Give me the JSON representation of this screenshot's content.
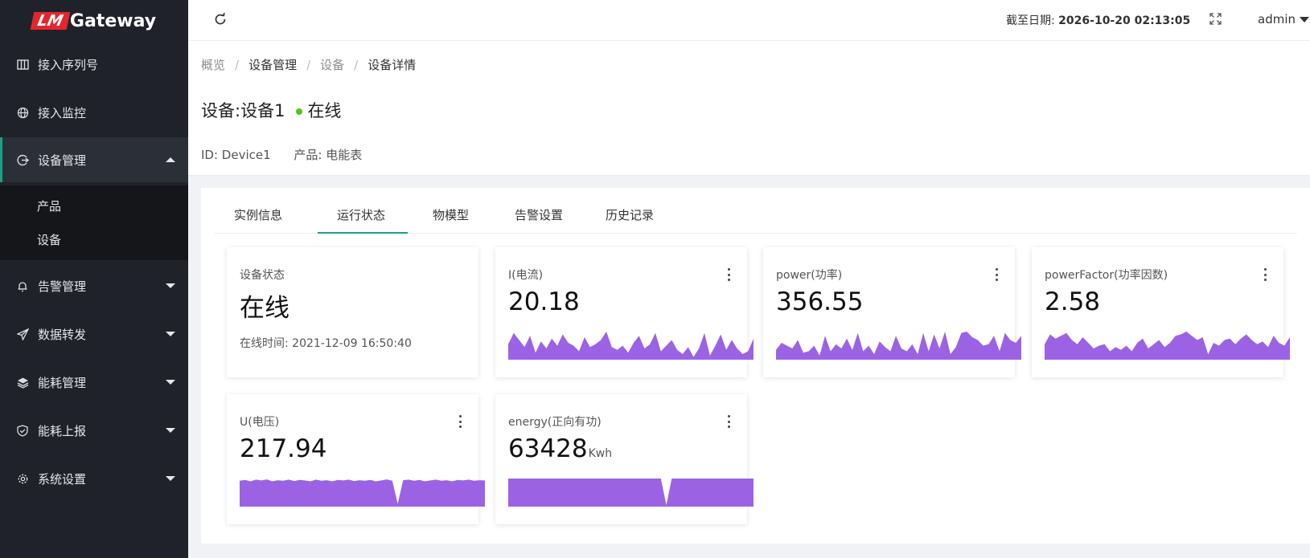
{
  "app": {
    "logo_mark": "LM",
    "logo_text": "Gateway"
  },
  "sidebar": {
    "items": [
      {
        "label": "接入序列号",
        "icon": "columns-icon"
      },
      {
        "label": "接入监控",
        "icon": "globe-icon"
      },
      {
        "label": "设备管理",
        "icon": "device-icon",
        "expanded": true
      },
      {
        "label": "告警管理",
        "icon": "bell-icon"
      },
      {
        "label": "数据转发",
        "icon": "send-icon"
      },
      {
        "label": "能耗管理",
        "icon": "layers-icon"
      },
      {
        "label": "能耗上报",
        "icon": "shield-check-icon"
      },
      {
        "label": "系统设置",
        "icon": "gear-icon"
      }
    ],
    "submenu": [
      "产品",
      "设备"
    ]
  },
  "header": {
    "date_label": "截至日期: ",
    "date_value": "2026-10-20 02:13:05",
    "user": "admin"
  },
  "breadcrumb": {
    "items": [
      "概览",
      "设备管理",
      "设备",
      "设备详情"
    ],
    "separator": "/"
  },
  "device": {
    "title": "设备:设备1",
    "status": "在线",
    "status_color": "#52c41a",
    "id_text": "ID: Device1",
    "product_text": "产品: 电能表"
  },
  "tabs": {
    "items": [
      "实例信息",
      "运行状态",
      "物模型",
      "告警设置",
      "历史记录"
    ],
    "active": "运行状态",
    "accent": "#1aa189"
  },
  "cards": {
    "status": {
      "title": "设备状态",
      "value": "在线",
      "time": "在线时间: 2021-12-09 16:50:40"
    },
    "metrics": [
      {
        "title": "I(电流)",
        "value": "20.18",
        "unit": "",
        "spark": [
          0.55,
          0.95,
          0.7,
          0.45,
          0.85,
          0.25,
          0.65,
          0.4,
          0.75,
          0.5,
          0.9,
          0.6,
          0.5,
          0.3,
          0.8,
          0.45,
          0.55,
          0.7,
          1.0,
          0.45,
          0.35,
          0.5,
          0.25,
          0.6,
          0.85,
          0.4,
          0.55,
          0.95,
          0.3,
          0.5,
          0.7,
          0.35,
          0.2,
          0.45,
          0.1,
          0.4,
          0.95,
          0.15,
          0.5,
          0.9,
          0.35,
          0.7,
          0.4,
          0.2,
          0.3,
          0.75
        ]
      },
      {
        "title": "power(功率)",
        "value": "356.55",
        "unit": "",
        "spark": [
          0.35,
          0.6,
          0.5,
          0.4,
          0.7,
          0.25,
          0.3,
          0.5,
          0.15,
          0.85,
          0.3,
          0.55,
          0.4,
          0.75,
          0.35,
          0.95,
          0.3,
          0.5,
          0.2,
          0.65,
          0.45,
          0.3,
          0.85,
          0.4,
          0.3,
          0.55,
          0.2,
          0.95,
          0.3,
          0.9,
          0.4,
          1.0,
          0.2,
          0.45,
          0.95,
          1.0,
          0.8,
          0.7,
          0.5,
          0.55,
          0.85,
          0.3,
          0.95,
          0.7,
          0.6,
          0.85
        ]
      },
      {
        "title": "powerFactor(功率因数)",
        "value": "2.58",
        "unit": "",
        "spark": [
          0.55,
          0.9,
          0.75,
          0.85,
          0.95,
          0.7,
          0.55,
          0.8,
          0.6,
          0.4,
          0.5,
          0.55,
          0.3,
          0.45,
          0.35,
          0.5,
          0.3,
          0.6,
          0.75,
          0.4,
          0.55,
          0.7,
          0.45,
          0.6,
          0.85,
          0.9,
          1.0,
          0.85,
          0.7,
          0.8,
          0.2,
          0.6,
          0.5,
          0.7,
          0.75,
          0.55,
          0.75,
          0.9,
          0.7,
          0.55,
          0.65,
          0.45,
          0.85,
          0.6,
          0.5,
          0.8
        ]
      },
      {
        "title": "U(电压)",
        "value": "217.94",
        "unit": "",
        "spark": [
          0.92,
          0.95,
          0.9,
          0.96,
          0.93,
          0.97,
          0.9,
          0.94,
          0.92,
          0.96,
          0.91,
          0.95,
          0.93,
          0.9,
          0.96,
          0.92,
          0.94,
          0.9,
          0.95,
          0.93,
          0.96,
          0.91,
          0.94,
          0.92,
          0.95,
          0.9,
          0.93,
          0.97,
          0.92,
          0.1,
          0.94,
          0.96,
          0.92,
          0.95,
          0.9,
          0.93,
          0.96,
          0.92,
          0.94,
          0.9,
          0.95,
          0.93,
          0.96,
          0.92,
          0.94,
          0.93
        ]
      },
      {
        "title": "energy(正向有功)",
        "value": "63428",
        "unit": "Kwh",
        "spark": [
          1,
          1,
          1,
          1,
          1,
          1,
          1,
          1,
          1,
          1,
          1,
          1,
          1,
          1,
          1,
          1,
          1,
          1,
          1,
          1,
          1,
          1,
          1,
          1,
          1,
          1,
          1,
          1,
          1,
          0.05,
          1,
          1,
          1,
          1,
          1,
          1,
          1,
          1,
          1,
          1,
          1,
          1,
          1,
          1,
          1,
          1
        ]
      }
    ],
    "spark_color": "#9b63e4"
  }
}
